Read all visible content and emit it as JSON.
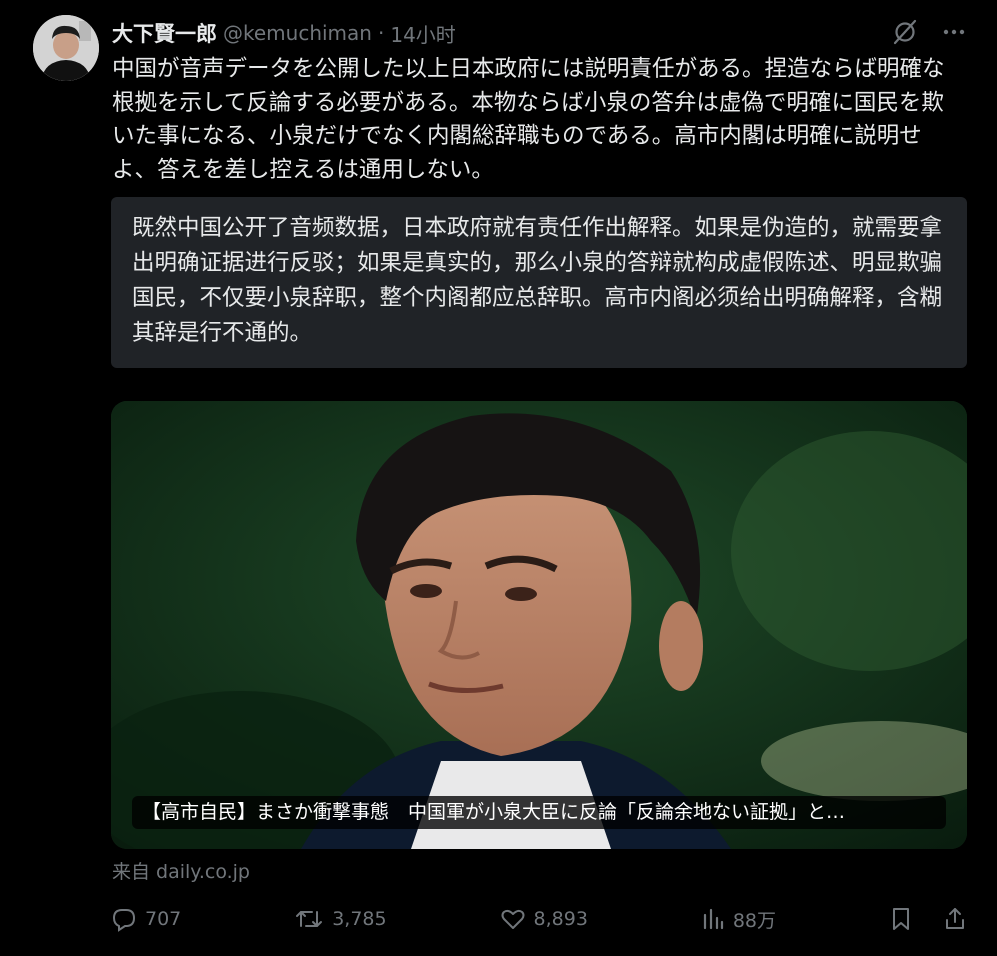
{
  "author": {
    "display_name": "大下賢一郎",
    "handle": "@kemuchiman",
    "separator": "·",
    "time": "14小时"
  },
  "tweet": {
    "text": "中国が音声データを公開した以上日本政府には説明責任がある。捏造ならば明確な根拠を示して反論する必要がある。本物ならば小泉の答弁は虚偽で明確に国民を欺いた事になる、小泉だけでなく内閣総辞職ものである。高市内閣は明確に説明せよ、答えを差し控えるは通用しない。"
  },
  "translation": {
    "text": "既然中国公开了音频数据，日本政府就有责任作出解释。如果是伪造的，就需要拿出明确证据进行反驳；如果是真实的，那么小泉的答辩就构成虚假陈述、明显欺骗国民，不仅要小泉辞职，整个内阁都应总辞职。高市内阁必须给出明确解释，含糊其辞是行不通的。"
  },
  "card": {
    "caption": "【高市自民】まさか衝撃事態　中国軍が小泉大臣に反論「反論余地ない証拠」と…",
    "source": "来自 daily.co.jp"
  },
  "actions": {
    "replies": "707",
    "retweets": "3,785",
    "likes": "8,893",
    "views": "88万"
  },
  "icons": {
    "top_right": [
      "grok-icon",
      "more-icon"
    ],
    "bottom": [
      "reply-icon",
      "retweet-icon",
      "like-icon",
      "views-icon",
      "bookmark-icon",
      "share-icon"
    ]
  },
  "colors": {
    "background": "#000000",
    "text": "#e7e9ea",
    "muted": "#71767b",
    "translation_bg": "#202327"
  }
}
